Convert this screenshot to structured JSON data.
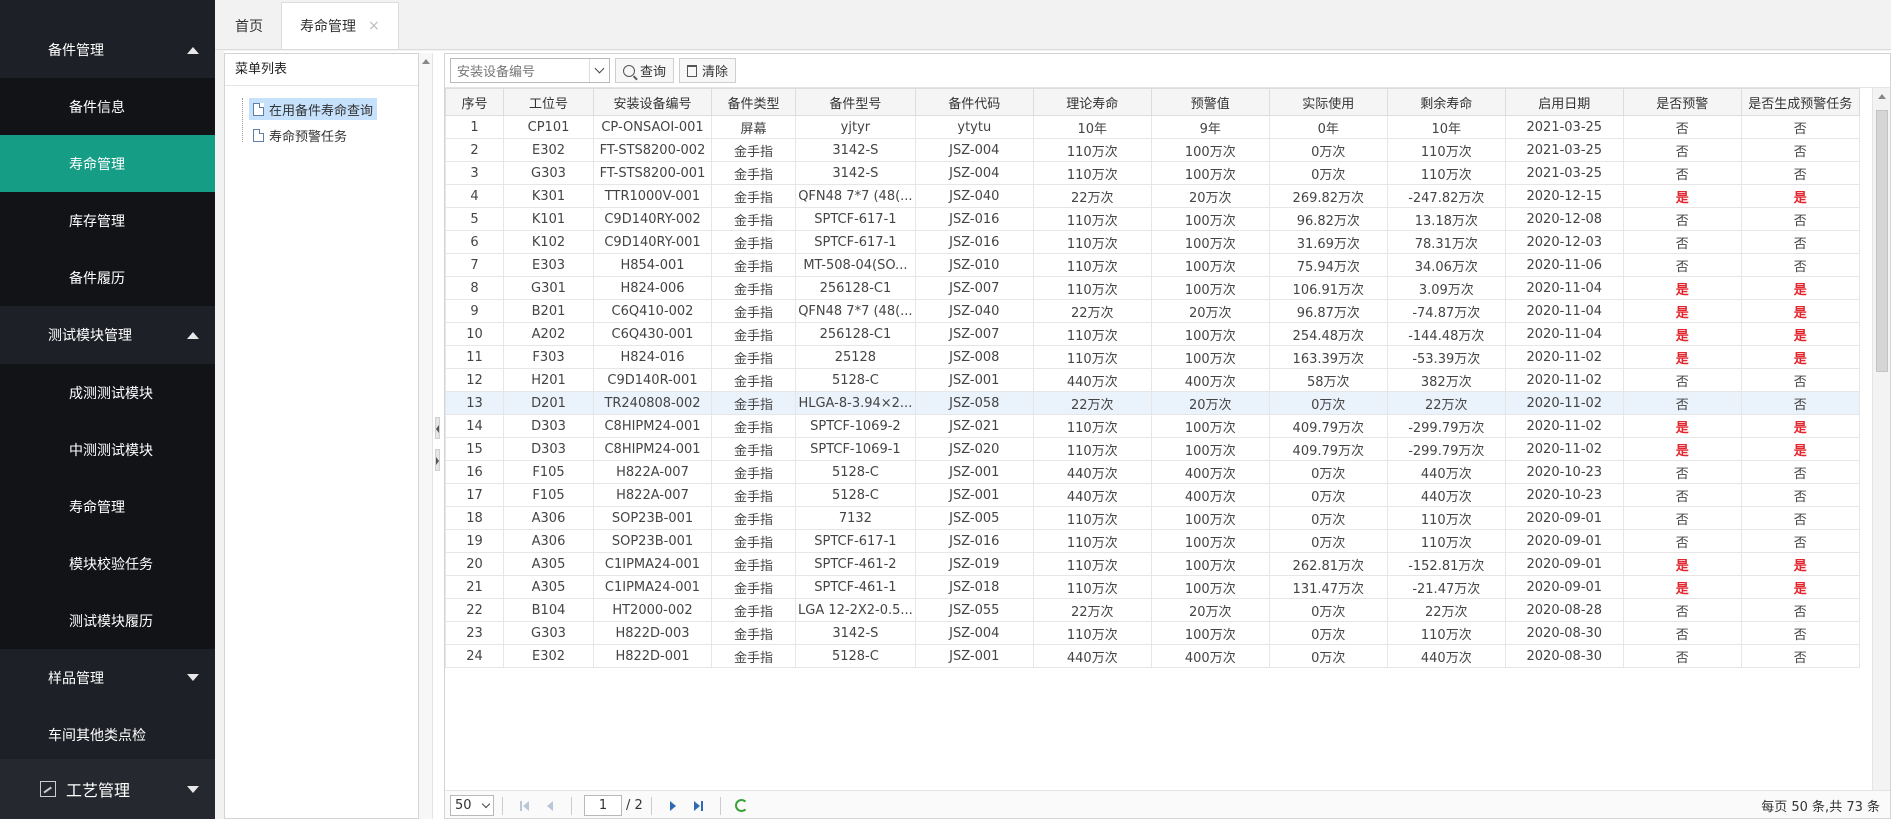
{
  "sidebar": {
    "groups": [
      {
        "label": "备件管理",
        "expanded": true,
        "items": [
          "备件信息",
          "寿命管理",
          "库存管理",
          "备件履历"
        ]
      },
      {
        "label": "测试模块管理",
        "expanded": true,
        "items": [
          "成测测试模块",
          "中测测试模块",
          "寿命管理",
          "模块校验任务",
          "测试模块履历"
        ]
      },
      {
        "label": "样品管理",
        "expanded": false,
        "items": []
      },
      {
        "label": "车间其他类点检",
        "expanded": false,
        "items": []
      }
    ],
    "active_item": "寿命管理",
    "bottom": {
      "label": "工艺管理",
      "icon": "chart-icon"
    }
  },
  "tabs": {
    "home": "首页",
    "active": "寿命管理",
    "close_glyph": "×"
  },
  "tree": {
    "header": "菜单列表",
    "nodes": [
      "在用备件寿命查询",
      "寿命预警任务"
    ],
    "selected": "在用备件寿命查询"
  },
  "toolbar": {
    "combo_placeholder": "安装设备编号",
    "query_label": "查询",
    "clear_label": "清除"
  },
  "table": {
    "columns": [
      "序号",
      "工位号",
      "安装设备编号",
      "备件类型",
      "备件型号",
      "备件代码",
      "理论寿命",
      "预警值",
      "实际使用",
      "剩余寿命",
      "启用日期",
      "是否预警",
      "是否生成预警任务"
    ],
    "rows": [
      [
        "1",
        "CP101",
        "CP-ONSAOI-001",
        "屏幕",
        "yjtyr",
        "ytytu",
        "10年",
        "9年",
        "0年",
        "10年",
        "2021-03-25",
        "否",
        "否"
      ],
      [
        "2",
        "E302",
        "FT-STS8200-002",
        "金手指",
        "3142-S",
        "JSZ-004",
        "110万次",
        "100万次",
        "0万次",
        "110万次",
        "2021-03-25",
        "否",
        "否"
      ],
      [
        "3",
        "G303",
        "FT-STS8200-001",
        "金手指",
        "3142-S",
        "JSZ-004",
        "110万次",
        "100万次",
        "0万次",
        "110万次",
        "2021-03-25",
        "否",
        "否"
      ],
      [
        "4",
        "K301",
        "TTR1000V-001",
        "金手指",
        "QFN48 7*7 (48(...",
        "JSZ-040",
        "22万次",
        "20万次",
        "269.82万次",
        "-247.82万次",
        "2020-12-15",
        "是",
        "是"
      ],
      [
        "5",
        "K101",
        "C9D140RY-002",
        "金手指",
        "SPTCF-617-1",
        "JSZ-016",
        "110万次",
        "100万次",
        "96.82万次",
        "13.18万次",
        "2020-12-08",
        "否",
        "否"
      ],
      [
        "6",
        "K102",
        "C9D140RY-001",
        "金手指",
        "SPTCF-617-1",
        "JSZ-016",
        "110万次",
        "100万次",
        "31.69万次",
        "78.31万次",
        "2020-12-03",
        "否",
        "否"
      ],
      [
        "7",
        "E303",
        "H854-001",
        "金手指",
        "MT-508-04(SO...",
        "JSZ-010",
        "110万次",
        "100万次",
        "75.94万次",
        "34.06万次",
        "2020-11-06",
        "否",
        "否"
      ],
      [
        "8",
        "G301",
        "H824-006",
        "金手指",
        "256128-C1",
        "JSZ-007",
        "110万次",
        "100万次",
        "106.91万次",
        "3.09万次",
        "2020-11-04",
        "是",
        "是"
      ],
      [
        "9",
        "B201",
        "C6Q410-002",
        "金手指",
        "QFN48 7*7 (48(...",
        "JSZ-040",
        "22万次",
        "20万次",
        "96.87万次",
        "-74.87万次",
        "2020-11-04",
        "是",
        "是"
      ],
      [
        "10",
        "A202",
        "C6Q430-001",
        "金手指",
        "256128-C1",
        "JSZ-007",
        "110万次",
        "100万次",
        "254.48万次",
        "-144.48万次",
        "2020-11-04",
        "是",
        "是"
      ],
      [
        "11",
        "F303",
        "H824-016",
        "金手指",
        "25128",
        "JSZ-008",
        "110万次",
        "100万次",
        "163.39万次",
        "-53.39万次",
        "2020-11-02",
        "是",
        "是"
      ],
      [
        "12",
        "H201",
        "C9D140R-001",
        "金手指",
        "5128-C",
        "JSZ-001",
        "440万次",
        "400万次",
        "58万次",
        "382万次",
        "2020-11-02",
        "否",
        "否"
      ],
      [
        "13",
        "D201",
        "TR240808-002",
        "金手指",
        "HLGA-8-3.94×2...",
        "JSZ-058",
        "22万次",
        "20万次",
        "0万次",
        "22万次",
        "2020-11-02",
        "否",
        "否"
      ],
      [
        "14",
        "D303",
        "C8HIPM24-001",
        "金手指",
        "SPTCF-1069-2",
        "JSZ-021",
        "110万次",
        "100万次",
        "409.79万次",
        "-299.79万次",
        "2020-11-02",
        "是",
        "是"
      ],
      [
        "15",
        "D303",
        "C8HIPM24-001",
        "金手指",
        "SPTCF-1069-1",
        "JSZ-020",
        "110万次",
        "100万次",
        "409.79万次",
        "-299.79万次",
        "2020-11-02",
        "是",
        "是"
      ],
      [
        "16",
        "F105",
        "H822A-007",
        "金手指",
        "5128-C",
        "JSZ-001",
        "440万次",
        "400万次",
        "0万次",
        "440万次",
        "2020-10-23",
        "否",
        "否"
      ],
      [
        "17",
        "F105",
        "H822A-007",
        "金手指",
        "5128-C",
        "JSZ-001",
        "440万次",
        "400万次",
        "0万次",
        "440万次",
        "2020-10-23",
        "否",
        "否"
      ],
      [
        "18",
        "A306",
        "SOP23B-001",
        "金手指",
        "7132",
        "JSZ-005",
        "110万次",
        "100万次",
        "0万次",
        "110万次",
        "2020-09-01",
        "否",
        "否"
      ],
      [
        "19",
        "A306",
        "SOP23B-001",
        "金手指",
        "SPTCF-617-1",
        "JSZ-016",
        "110万次",
        "100万次",
        "0万次",
        "110万次",
        "2020-09-01",
        "否",
        "否"
      ],
      [
        "20",
        "A305",
        "C1IPMA24-001",
        "金手指",
        "SPTCF-461-2",
        "JSZ-019",
        "110万次",
        "100万次",
        "262.81万次",
        "-152.81万次",
        "2020-09-01",
        "是",
        "是"
      ],
      [
        "21",
        "A305",
        "C1IPMA24-001",
        "金手指",
        "SPTCF-461-1",
        "JSZ-018",
        "110万次",
        "100万次",
        "131.47万次",
        "-21.47万次",
        "2020-09-01",
        "是",
        "是"
      ],
      [
        "22",
        "B104",
        "HT2000-002",
        "金手指",
        "LGA 12-2X2-0.5...",
        "JSZ-055",
        "22万次",
        "20万次",
        "0万次",
        "22万次",
        "2020-08-28",
        "否",
        "否"
      ],
      [
        "23",
        "G303",
        "H822D-003",
        "金手指",
        "3142-S",
        "JSZ-004",
        "110万次",
        "100万次",
        "0万次",
        "110万次",
        "2020-08-30",
        "否",
        "否"
      ],
      [
        "24",
        "E302",
        "H822D-001",
        "金手指",
        "5128-C",
        "JSZ-001",
        "440万次",
        "400万次",
        "0万次",
        "440万次",
        "2020-08-30",
        "否",
        "否"
      ]
    ],
    "highlighted_row": "13",
    "warn_color": "#e3262e"
  },
  "pager": {
    "page_size": "50",
    "current_page": "1",
    "total_pages": "/ 2",
    "info": "每页 50 条,共 73 条"
  },
  "colors": {
    "sidebar_bg": "#1d2026",
    "active_item_bg": "#159d86",
    "selected_tree_bg": "#c6e1fb"
  }
}
